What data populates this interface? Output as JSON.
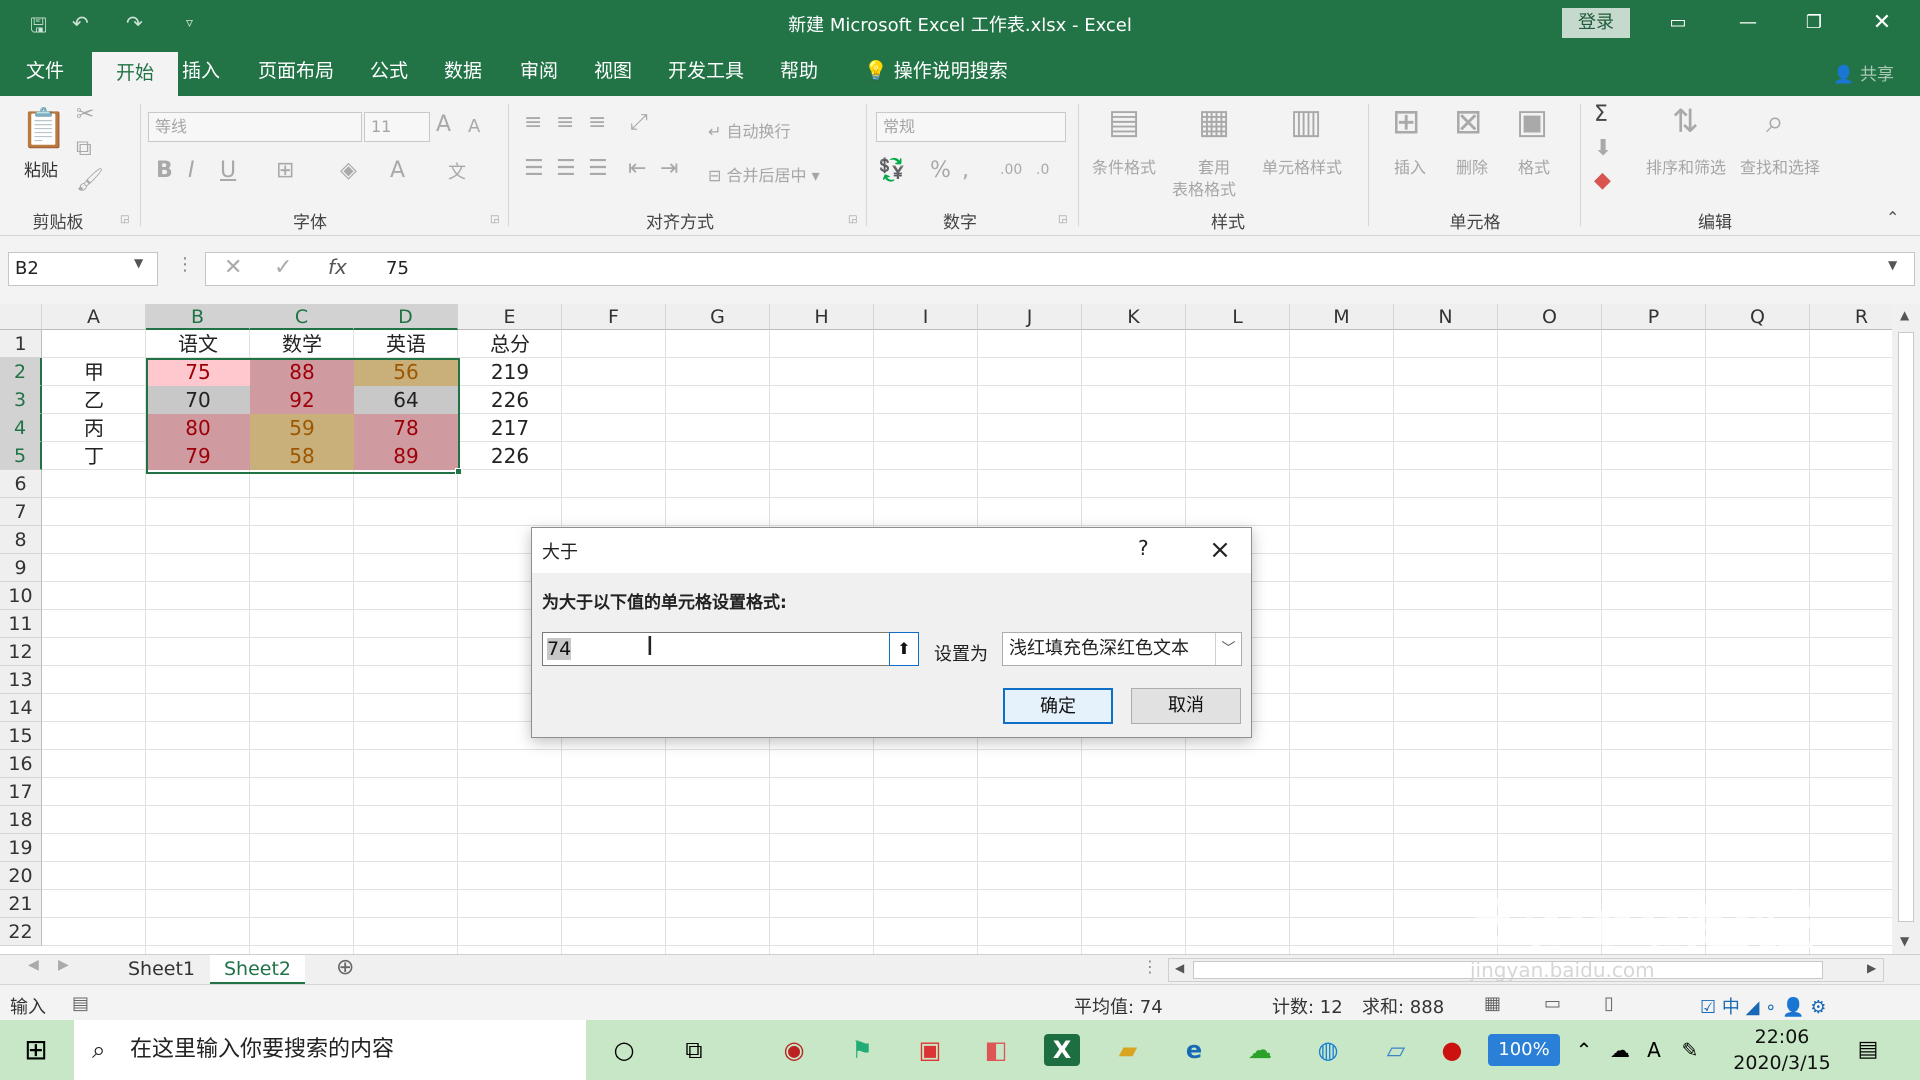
{
  "titlebar": {
    "title": "新建 Microsoft Excel 工作表.xlsx  -  Excel",
    "login": "登录",
    "quick_access": [
      "save-icon",
      "undo-icon",
      "redo-icon",
      "customize-icon"
    ]
  },
  "tabs": [
    "文件",
    "开始",
    "插入",
    "页面布局",
    "公式",
    "数据",
    "审阅",
    "视图",
    "开发工具",
    "帮助"
  ],
  "active_tab": "开始",
  "tell_me": "操作说明搜索",
  "share": "共享",
  "ribbon": {
    "clipboard": {
      "label": "剪贴板",
      "paste": "粘贴"
    },
    "font": {
      "label": "字体",
      "font_name": "等线",
      "font_size": "11"
    },
    "alignment": {
      "label": "对齐方式",
      "wrap": "自动换行",
      "merge": "合并后居中"
    },
    "number": {
      "label": "数字",
      "format": "常规"
    },
    "styles": {
      "label": "样式",
      "conditional": "条件格式",
      "table_a": "套用",
      "table_b": "表格格式",
      "cell_styles": "单元格样式"
    },
    "cells": {
      "label": "单元格",
      "insert": "插入",
      "delete": "删除",
      "format": "格式"
    },
    "editing": {
      "label": "编辑",
      "sort": "排序和筛选",
      "find": "查找和选择"
    }
  },
  "formula_bar": {
    "name_box": "B2",
    "value": "75",
    "fx": "fx"
  },
  "columns": [
    "A",
    "B",
    "C",
    "D",
    "E",
    "F",
    "G",
    "H",
    "I",
    "J",
    "K",
    "L",
    "M",
    "N",
    "O",
    "P",
    "Q",
    "R"
  ],
  "rows": [
    "1",
    "2",
    "3",
    "4",
    "5",
    "6",
    "7",
    "8",
    "9",
    "10",
    "11",
    "12",
    "13",
    "14",
    "15",
    "16",
    "17",
    "18",
    "19",
    "20",
    "21",
    "22"
  ],
  "sheet": {
    "headers": [
      "",
      "语文",
      "数学",
      "英语",
      "总分"
    ],
    "data": [
      [
        "甲",
        "75",
        "88",
        "56",
        "219"
      ],
      [
        "乙",
        "70",
        "92",
        "64",
        "226"
      ],
      [
        "丙",
        "80",
        "59",
        "78",
        "217"
      ],
      [
        "丁",
        "79",
        "58",
        "89",
        "226"
      ]
    ]
  },
  "sheet_tabs": [
    "Sheet1",
    "Sheet2"
  ],
  "active_sheet": "Sheet2",
  "status": {
    "mode": "输入",
    "average": "平均值: 74",
    "count": "计数: 12",
    "sum": "求和: 888"
  },
  "dialog": {
    "title": "大于",
    "help": "?",
    "prompt": "为大于以下值的单元格设置格式:",
    "value": "74",
    "set_as_label": "设置为",
    "format_option": "浅红填充色深红色文本",
    "ok": "确定",
    "cancel": "取消"
  },
  "taskbar": {
    "search_placeholder": "在这里输入你要搜索的内容",
    "time": "22:06",
    "date": "2020/3/15",
    "zoom_badge": "100%"
  },
  "watermark": {
    "main": "Baidu经验",
    "sub": "jingyan.baidu.com"
  },
  "colors": {
    "excel_green": "#227447",
    "light_red_fill": "#ffc7ce",
    "dark_red_text": "#9c0006"
  }
}
